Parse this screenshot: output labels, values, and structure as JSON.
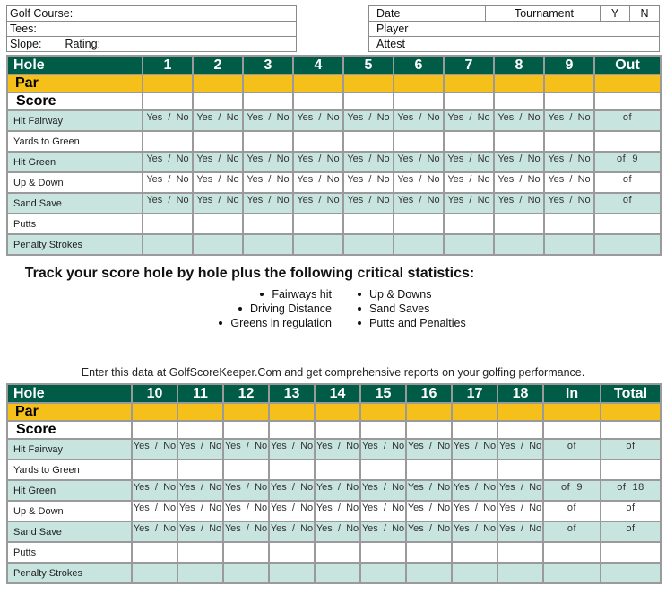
{
  "header_left": {
    "golf_course_label": "Golf Course:",
    "tees_label": "Tees:",
    "slope_label": "Slope:",
    "rating_label": "Rating:"
  },
  "header_right": {
    "date_label": "Date",
    "tournament_label": "Tournament",
    "yes_label": "Y",
    "no_label": "N",
    "player_label": "Player",
    "attest_label": "Attest"
  },
  "front_nine": {
    "hole_label": "Hole",
    "holes": [
      "1",
      "2",
      "3",
      "4",
      "5",
      "6",
      "7",
      "8",
      "9"
    ],
    "total_label": "Out",
    "par_label": "Par",
    "score_label": "Score",
    "stats": [
      {
        "label": "Hit Fairway",
        "cell": "Yes  /  No",
        "summary": "of"
      },
      {
        "label": "Yards to Green",
        "cell": "",
        "summary": ""
      },
      {
        "label": "Hit Green",
        "cell": "Yes  /  No",
        "summary": "of  9"
      },
      {
        "label": "Up & Down",
        "cell": "Yes  /  No",
        "summary": "of"
      },
      {
        "label": "Sand Save",
        "cell": "Yes  /  No",
        "summary": "of"
      },
      {
        "label": "Putts",
        "cell": "",
        "summary": ""
      },
      {
        "label": "Penalty Strokes",
        "cell": "",
        "summary": ""
      }
    ]
  },
  "promo": {
    "title": "Track your score hole by hole plus the following critical statistics:",
    "left_bullets": [
      "Fairways hit",
      "Driving Distance",
      "Greens in regulation"
    ],
    "right_bullets": [
      "Up & Downs",
      "Sand Saves",
      "Putts and Penalties"
    ],
    "enter_text": "Enter this data at GolfScoreKeeper.Com and get comprehensive reports on your golfing performance."
  },
  "back_nine": {
    "hole_label": "Hole",
    "holes": [
      "10",
      "11",
      "12",
      "13",
      "14",
      "15",
      "16",
      "17",
      "18"
    ],
    "in_label": "In",
    "total_label": "Total",
    "par_label": "Par",
    "score_label": "Score",
    "stats": [
      {
        "label": "Hit Fairway",
        "cell": "Yes  /  No",
        "in": "of",
        "total": "of"
      },
      {
        "label": "Yards to Green",
        "cell": "",
        "in": "",
        "total": ""
      },
      {
        "label": "Hit Green",
        "cell": "Yes  /  No",
        "in": "of  9",
        "total": "of  18"
      },
      {
        "label": "Up & Down",
        "cell": "Yes  /  No",
        "in": "of",
        "total": "of"
      },
      {
        "label": "Sand Save",
        "cell": "Yes  /  No",
        "in": "of",
        "total": "of"
      },
      {
        "label": "Putts",
        "cell": "",
        "in": "",
        "total": ""
      },
      {
        "label": "Penalty Strokes",
        "cell": "",
        "in": "",
        "total": ""
      }
    ]
  },
  "colors": {
    "header_green": "#005c46",
    "par_yellow": "#f6c01a",
    "stat_teal": "#c8e4df"
  }
}
